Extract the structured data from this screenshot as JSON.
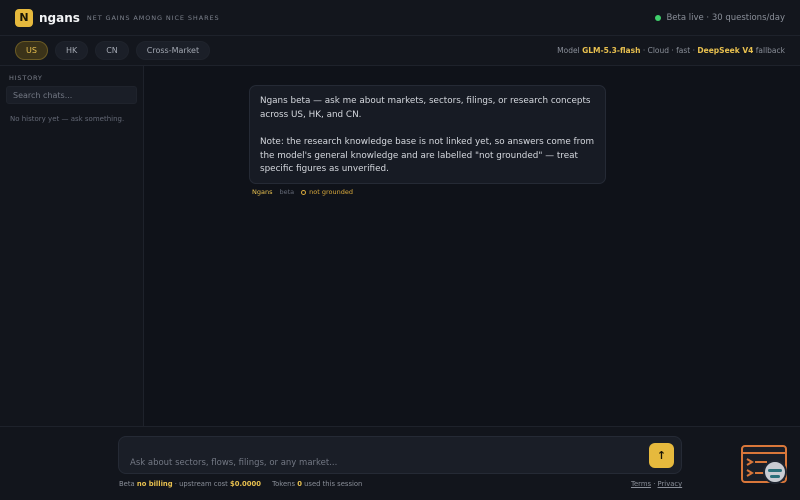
{
  "header": {
    "logo_letter": "N",
    "brand": "ngans",
    "tagline": "NET GAINS AMONG NICE SHARES",
    "status": "Beta live · 30 questions/day",
    "status_color": "#3fcf6b"
  },
  "markets": {
    "tabs": [
      {
        "label": "US",
        "active": true
      },
      {
        "label": "HK",
        "active": false
      },
      {
        "label": "CN",
        "active": false
      },
      {
        "label": "Cross-Market",
        "active": false
      }
    ]
  },
  "model": {
    "prefix": "Model",
    "name": "GLM-5.3-flash",
    "details": "· Cloud · fast ·",
    "fallback_name": "DeepSeek V4",
    "fallback_suffix": "fallback"
  },
  "sidebar": {
    "title": "HISTORY",
    "search_placeholder": "Search chats...",
    "empty_text": "No history yet — ask something."
  },
  "message": {
    "paragraph1": "Ngans beta — ask me about markets, sectors, filings, or research concepts across US, HK, and CN.",
    "paragraph2": "Note: the research knowledge base is not linked yet, so answers come from the model's general knowledge and are labelled \"not grounded\" — treat specific figures as unverified.",
    "author": "Ngans",
    "badge": "beta",
    "grounding": "not grounded"
  },
  "composer": {
    "placeholder": "Ask about sectors, flows, filings, or any market...",
    "send_icon": "↑"
  },
  "footer": {
    "beta": "Beta",
    "no_billing": "no billing",
    "upstream_label": "· upstream cost",
    "upstream_value": "$0.0000",
    "tokens_label": "Tokens",
    "tokens_value": "0",
    "tokens_suffix": "used this session",
    "terms": "Terms",
    "dot": "·",
    "privacy": "Privacy"
  },
  "colors": {
    "accent": "#e6b93d",
    "background": "#0f1219",
    "widget": "#d9773a"
  }
}
